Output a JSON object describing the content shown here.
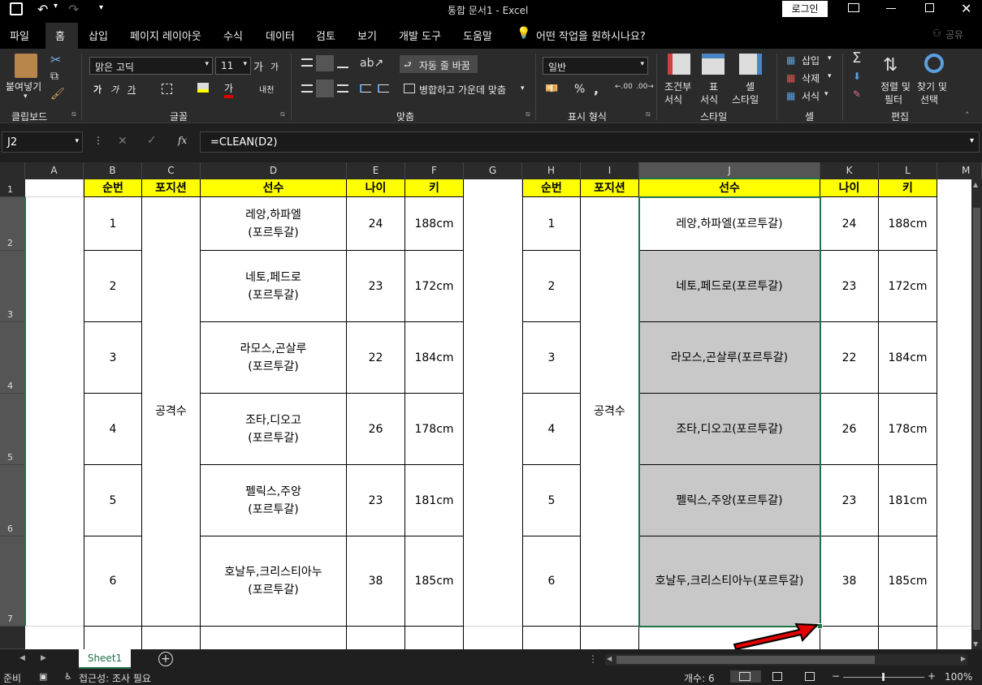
{
  "window": {
    "title": "통합 문서1  -  Excel",
    "login_label": "로그인"
  },
  "ribbon_tabs": [
    "파일",
    "홈",
    "삽입",
    "페이지 레이아웃",
    "수식",
    "데이터",
    "검토",
    "보기",
    "개발 도구",
    "도움말"
  ],
  "tell_me": "어떤 작업을 원하시나요?",
  "share_label": "공유",
  "clipboard": {
    "paste_label": "붙여넣기",
    "group_label": "클립보드"
  },
  "font": {
    "name": "맑은 고딕",
    "size": "11",
    "group_label": "글꼴",
    "bold": "가",
    "italic": "가",
    "underline": "가",
    "grow": "가",
    "shrink": "가",
    "color_a": "가",
    "phonetic": "내천"
  },
  "alignment": {
    "wrap_label": "자동 줄 바꿈",
    "merge_label": "병합하고 가운데 맞춤",
    "group_label": "맞춤"
  },
  "number": {
    "format": "일반",
    "percent": "%",
    "comma": ",",
    "group_label": "표시 형식"
  },
  "styles": {
    "cond_line1": "조건부",
    "cond_line2": "서식",
    "table_line1": "표",
    "table_line2": "서식",
    "cell_line1": "셀",
    "cell_line2": "스타일",
    "group_label": "스타일"
  },
  "cells": {
    "insert": "삽입",
    "delete": "삭제",
    "format": "서식",
    "group_label": "셀"
  },
  "editing": {
    "sort_line1": "정렬 및",
    "sort_line2": "필터",
    "find_line1": "찾기 및",
    "find_line2": "선택",
    "group_label": "편집"
  },
  "formula_bar": {
    "name_box": "J2",
    "fx": "fx",
    "formula": "=CLEAN(D2)"
  },
  "columns": [
    "A",
    "B",
    "C",
    "D",
    "E",
    "F",
    "G",
    "H",
    "I",
    "J",
    "K",
    "L",
    "M"
  ],
  "rows": [
    "1",
    "2",
    "3",
    "4",
    "5",
    "6",
    "7"
  ],
  "left_table": {
    "headers": [
      "순번",
      "포지션",
      "선수",
      "나이",
      "키"
    ],
    "position": "공격수",
    "rows": [
      {
        "no": "1",
        "name1": "레앙,하파엘",
        "name2": "(포르투갈)",
        "age": "24",
        "height": "188cm"
      },
      {
        "no": "2",
        "name1": "네토,페드로",
        "name2": "(포르투갈)",
        "age": "23",
        "height": "172cm"
      },
      {
        "no": "3",
        "name1": "라모스,곤살루",
        "name2": "(포르투갈)",
        "age": "22",
        "height": "184cm"
      },
      {
        "no": "4",
        "name1": "조타,디오고",
        "name2": "(포르투갈)",
        "age": "26",
        "height": "178cm"
      },
      {
        "no": "5",
        "name1": "펠릭스,주앙",
        "name2": "(포르투갈)",
        "age": "23",
        "height": "181cm"
      },
      {
        "no": "6",
        "name1": "호날두,크리스티아누",
        "name2": "(포르투갈)",
        "age": "38",
        "height": "185cm"
      }
    ]
  },
  "right_table": {
    "headers": [
      "순번",
      "포지션",
      "선수",
      "나이",
      "키"
    ],
    "position": "공격수",
    "rows": [
      {
        "no": "1",
        "name": "레앙,하파엘(포르투갈)",
        "age": "24",
        "height": "188cm"
      },
      {
        "no": "2",
        "name": "네토,페드로(포르투갈)",
        "age": "23",
        "height": "172cm"
      },
      {
        "no": "3",
        "name": "라모스,곤살루(포르투갈)",
        "age": "22",
        "height": "184cm"
      },
      {
        "no": "4",
        "name": "조타,디오고(포르투갈)",
        "age": "26",
        "height": "178cm"
      },
      {
        "no": "5",
        "name": "펠릭스,주앙(포르투갈)",
        "age": "23",
        "height": "181cm"
      },
      {
        "no": "6",
        "name": "호날두,크리스티아누(포르투갈)",
        "age": "38",
        "height": "185cm"
      }
    ]
  },
  "sheet_tab": "Sheet1",
  "status": {
    "ready": "준비",
    "accessibility": "접근성: 조사 필요",
    "count": "개수: 6",
    "zoom": "100%"
  },
  "colors": {
    "header_fill": "#ffff00",
    "selected_fill": "#c8c8c8",
    "selection_border": "#217346",
    "arrow": "#e00000"
  }
}
